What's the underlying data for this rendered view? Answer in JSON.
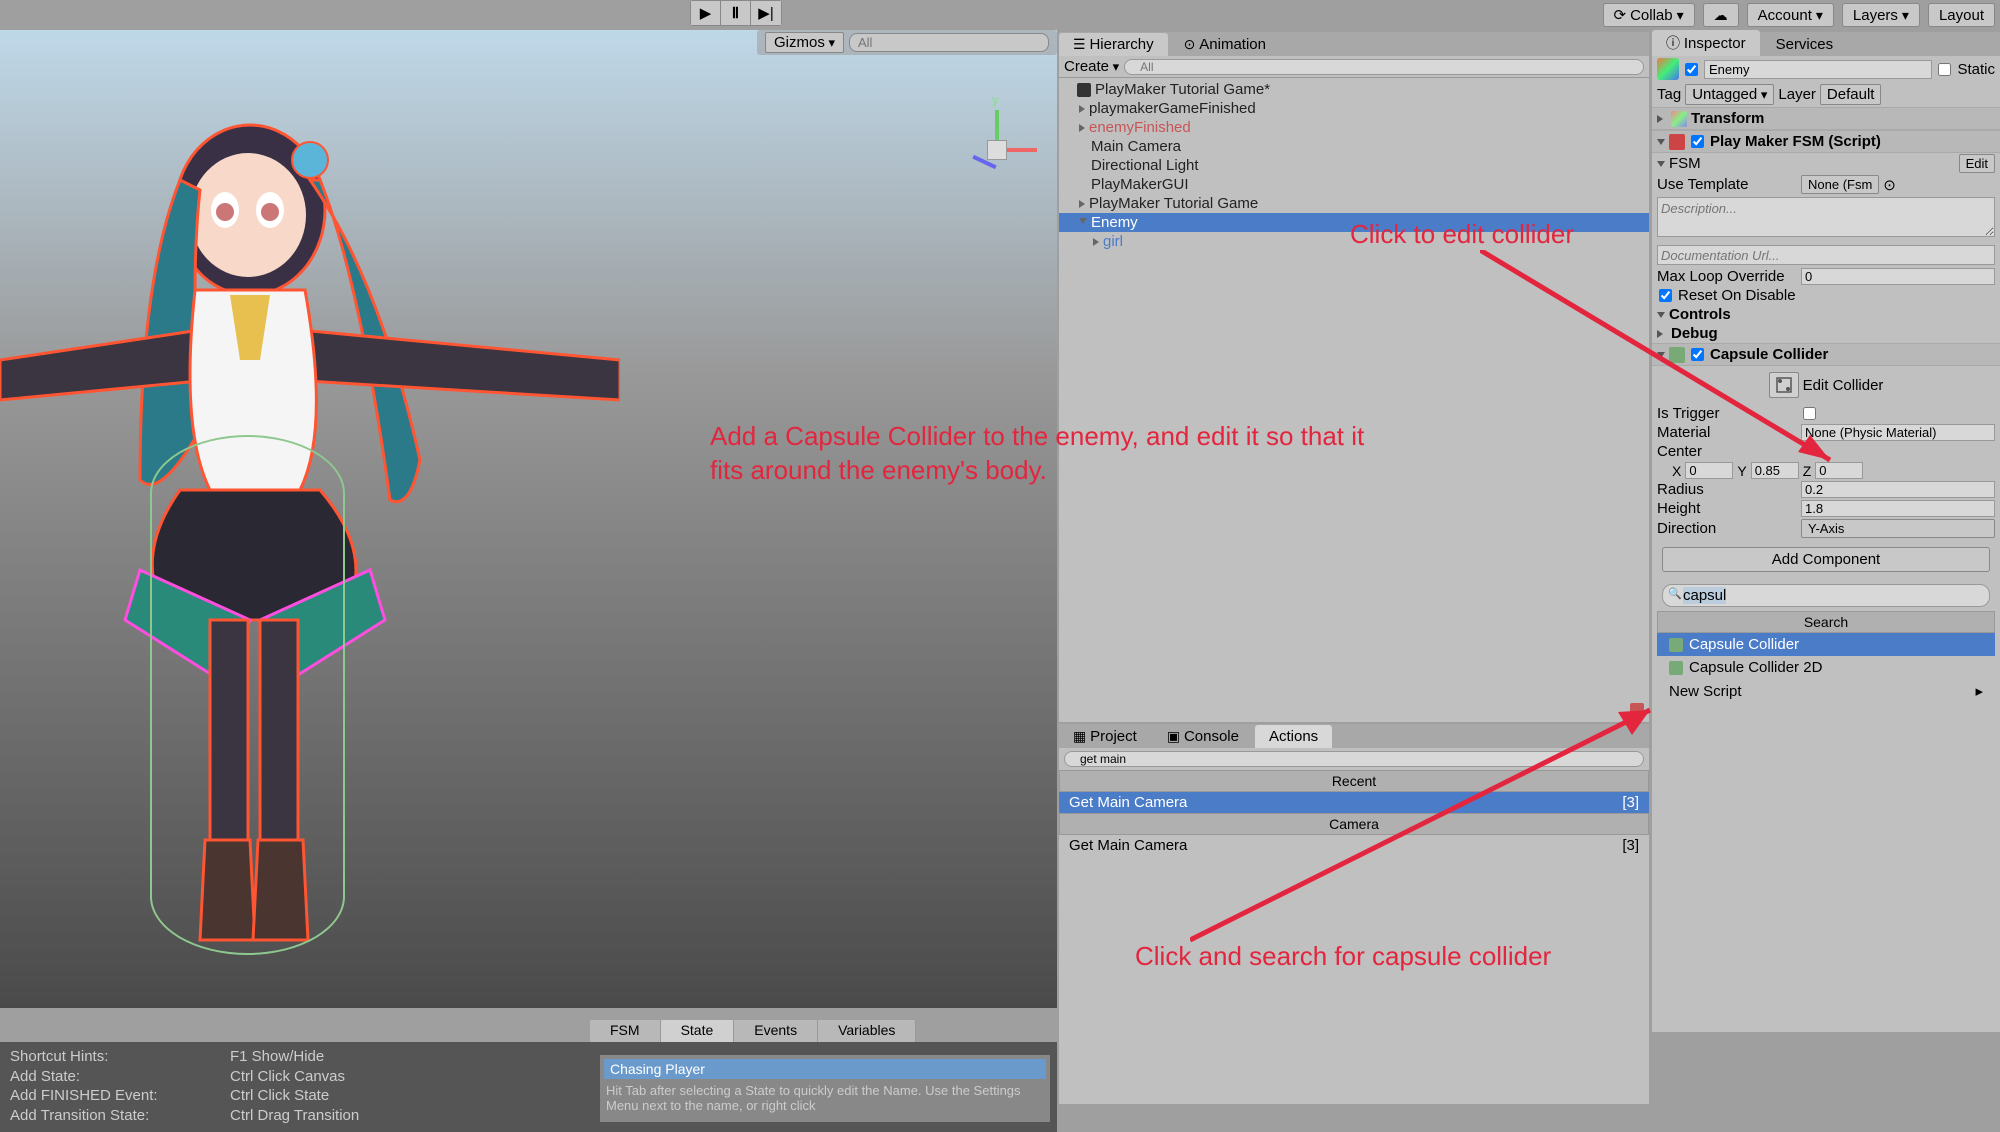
{
  "toolbar": {
    "collab": "Collab",
    "account": "Account",
    "layers": "Layers",
    "layout": "Layout"
  },
  "scene": {
    "gizmos": "Gizmos",
    "all_search": "All",
    "axis_y": "y"
  },
  "hierarchy": {
    "tab_hierarchy": "Hierarchy",
    "tab_animation": "Animation",
    "create": "Create",
    "search_ph": "All",
    "items": [
      {
        "label": "PlayMaker Tutorial Game*",
        "root": true
      },
      {
        "label": "playmakerGameFinished",
        "nested": 1,
        "expand": true
      },
      {
        "label": "enemyFinished",
        "nested": 1,
        "red": true,
        "expand": true
      },
      {
        "label": "Main Camera",
        "nested": 1
      },
      {
        "label": "Directional Light",
        "nested": 1
      },
      {
        "label": "PlayMakerGUI",
        "nested": 1
      },
      {
        "label": "PlayMaker Tutorial Game",
        "nested": 1,
        "expand": true
      },
      {
        "label": "Enemy",
        "nested": 1,
        "selected": true,
        "expand": "open"
      },
      {
        "label": "girl",
        "nested": 2,
        "blue": true,
        "expand": true
      }
    ]
  },
  "project": {
    "tab_project": "Project",
    "tab_console": "Console",
    "tab_actions": "Actions",
    "search_value": "get main",
    "recent_header": "Recent",
    "recent_item": "Get Main Camera",
    "recent_badge": "[3]",
    "camera_header": "Camera",
    "camera_item": "Get Main Camera",
    "camera_badge": "[3]"
  },
  "inspector": {
    "tab_inspector": "Inspector",
    "tab_services": "Services",
    "name": "Enemy",
    "static_label": "Static",
    "tag_label": "Tag",
    "tag_value": "Untagged",
    "layer_label": "Layer",
    "layer_value": "Default",
    "transform": "Transform",
    "playmaker_fsm": "Play Maker FSM (Script)",
    "fsm_label": "FSM",
    "fsm_edit": "Edit",
    "use_template": "Use Template",
    "template_value": "None (Fsm",
    "description_ph": "Description...",
    "doc_url": "Documentation Url...",
    "max_loop": "Max Loop Override",
    "max_loop_val": "0",
    "reset_disable": "Reset On Disable",
    "controls": "Controls",
    "debug": "Debug",
    "capsule_collider": "Capsule Collider",
    "edit_collider": "Edit Collider",
    "is_trigger": "Is Trigger",
    "material": "Material",
    "material_val": "None (Physic Material)",
    "center": "Center",
    "center_x": "0",
    "center_y": "0.85",
    "center_z": "0",
    "radius": "Radius",
    "radius_val": "0.2",
    "height": "Height",
    "height_val": "1.8",
    "direction": "Direction",
    "direction_val": "Y-Axis",
    "add_component": "Add Component",
    "search_value": "capsul",
    "search_header": "Search",
    "result_1": "Capsule Collider",
    "result_2": "Capsule Collider 2D",
    "result_3": "New Script"
  },
  "annotations": {
    "main": "Add a Capsule Collider to the enemy, and edit it so that it fits around the enemy's body.",
    "edit_collider": "Click to edit collider",
    "search": "Click and search for capsule collider"
  },
  "bottom": {
    "hints_title": "Shortcut Hints:",
    "hints": [
      {
        "k": "Add State:",
        "v": "F1 Show/Hide"
      },
      {
        "k": "Add State:",
        "v": "Ctrl Click Canvas"
      },
      {
        "k": "Add FINISHED Event:",
        "v": "Ctrl Click State"
      },
      {
        "k": "Add Transition State:",
        "v": "Ctrl Drag Transition"
      }
    ],
    "fsm_tabs": [
      "FSM",
      "State",
      "Events",
      "Variables"
    ],
    "state_name": "Chasing Player",
    "state_hint": "Hit Tab after selecting a State to quickly edit the Name. Use the Settings Menu next to the name, or right click"
  }
}
